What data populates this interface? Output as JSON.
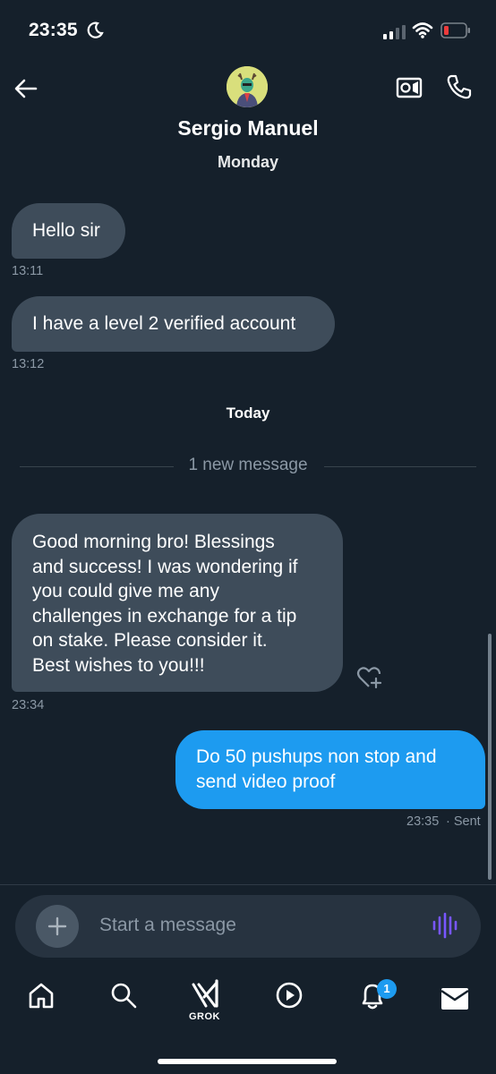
{
  "status_bar": {
    "time": "23:35"
  },
  "header": {
    "contact_name": "Sergio Manuel",
    "day_label": "Monday"
  },
  "messages_monday": [
    {
      "text": "Hello sir",
      "time": "13:11"
    },
    {
      "text": "I have a level 2 verified account",
      "time": "13:12"
    }
  ],
  "today_label": "Today",
  "new_message_divider": "1 new message",
  "incoming_today": {
    "lines": [
      "Good morning bro! Blessings",
      "and success! I was wondering if",
      "you could give me any",
      "challenges in exchange for a tip",
      "on stake. Please consider it.",
      "Best wishes to you!!!"
    ],
    "time": "23:34"
  },
  "outgoing": {
    "lines": [
      "Do 50 pushups non stop and",
      "send video proof"
    ],
    "time": "23:35",
    "status": "· Sent"
  },
  "composer": {
    "placeholder": "Start a message"
  },
  "tab_bar": {
    "grok_label": "GROK",
    "notification_count": "1"
  },
  "colors": {
    "background": "#15202b",
    "received_bubble": "#3e4c5a",
    "sent_bubble": "#1d9bf0",
    "muted_text": "#8b98a5",
    "voice_icon": "#7856ff"
  },
  "icons": [
    "moon-icon",
    "signal-icon",
    "wifi-icon",
    "battery-icon",
    "back-arrow-icon",
    "video-call-icon",
    "phone-icon",
    "add-reaction-icon",
    "plus-icon",
    "voice-icon",
    "home-icon",
    "search-icon",
    "grok-icon",
    "play-icon",
    "bell-icon",
    "mail-icon"
  ]
}
